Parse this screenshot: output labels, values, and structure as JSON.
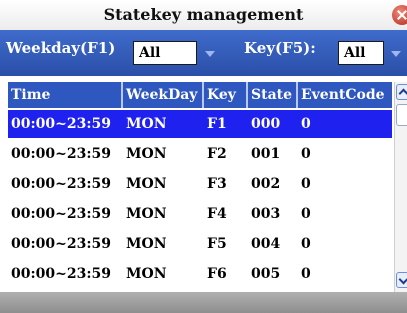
{
  "window": {
    "title": "Statekey management"
  },
  "filters": {
    "weekday_label": "Weekday(F1)",
    "weekday_value": "All",
    "key_label": "Key(F5):",
    "key_value": "All"
  },
  "table": {
    "columns": [
      "Time",
      "WeekDay",
      "Key",
      "State",
      "EventCode"
    ],
    "rows": [
      [
        "00:00~23:59",
        "MON",
        "F1",
        "000",
        "0"
      ],
      [
        "00:00~23:59",
        "MON",
        "F2",
        "001",
        "0"
      ],
      [
        "00:00~23:59",
        "MON",
        "F3",
        "002",
        "0"
      ],
      [
        "00:00~23:59",
        "MON",
        "F4",
        "003",
        "0"
      ],
      [
        "00:00~23:59",
        "MON",
        "F5",
        "004",
        "0"
      ],
      [
        "00:00~23:59",
        "MON",
        "F6",
        "005",
        "0"
      ]
    ],
    "selected_row": 0
  },
  "colors": {
    "filter_bar": "#2f57c0",
    "header_bg": "#2f57c0",
    "selected_row": "#1f22ee"
  }
}
